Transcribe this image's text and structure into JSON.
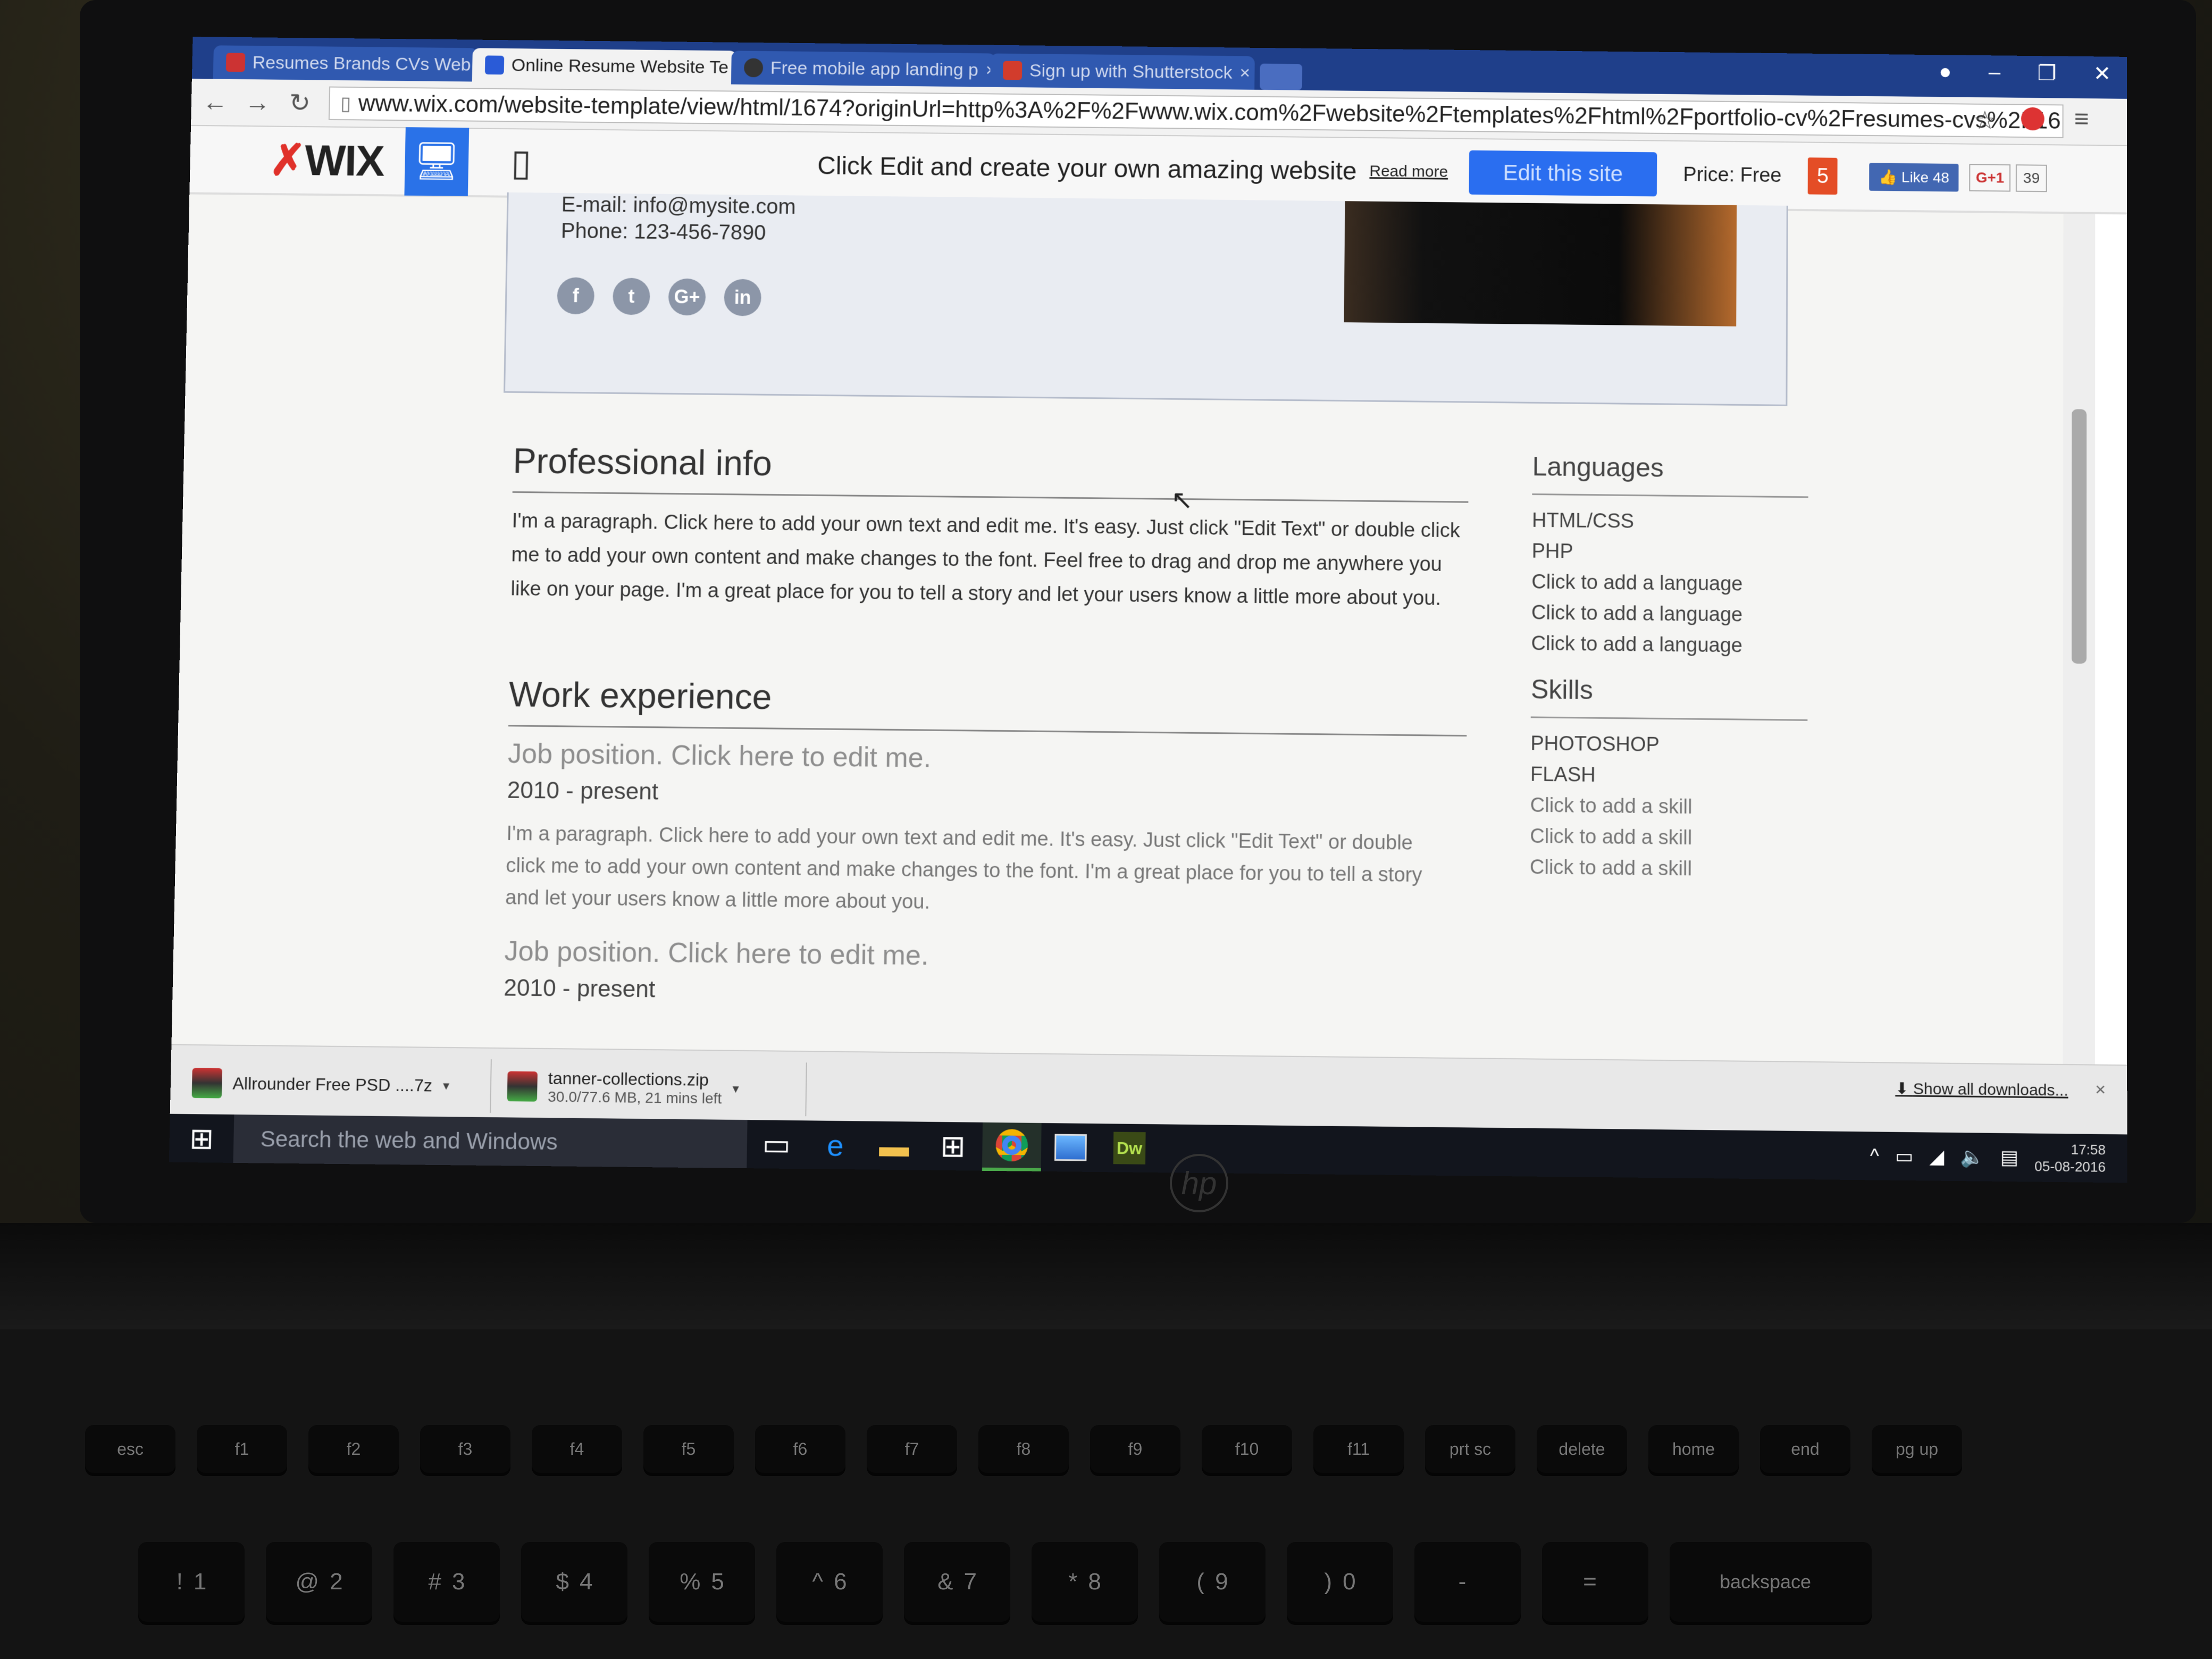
{
  "browser": {
    "tabs": [
      {
        "label": "Resumes Brands CVs Web",
        "active": false
      },
      {
        "label": "Online Resume Website Te",
        "active": true
      },
      {
        "label": "Free mobile app landing p",
        "active": false
      },
      {
        "label": "Sign up with Shutterstock",
        "active": false
      }
    ],
    "url": "www.wix.com/website-template/view/html/1674?originUrl=http%3A%2F%2Fwww.wix.com%2Fwebsite%2Ftemplates%2Fhtml%2Fportfolio-cv%2Fresumes-cvs%2F16"
  },
  "wixbar": {
    "logo": "WIX",
    "message": "Click Edit and create your own amazing website",
    "read_more": "Read more",
    "edit_button": "Edit this site",
    "price": "Price: Free",
    "html5": "5",
    "like": "Like 48",
    "gplus": "G+1",
    "gplus_count": "39"
  },
  "contact": {
    "email": "E-mail: info@mysite.com",
    "phone": "Phone: 123-456-7890",
    "social": [
      "f",
      "t",
      "G+",
      "in"
    ]
  },
  "main": {
    "professional_title": "Professional info",
    "professional_para": "I'm a paragraph. Click here to add your own text and edit me. It's easy. Just click \"Edit Text\" or double click me to add your own content and make changes to the font. Feel free to drag and drop me anywhere you like on your page. I'm a great place for you to tell a story and let your users know a little more about you.",
    "work_title": "Work experience",
    "jobs": [
      {
        "position": "Job position. Click here to edit me.",
        "dates": "2010 - present",
        "para": "I'm a paragraph. Click here to add your own text and edit me. It's easy. Just click \"Edit Text\" or double click me to add your own content and make changes to the font. I'm a great place for you to tell a story and let your users know a little more about you."
      },
      {
        "position": "Job position. Click here to edit me.",
        "dates": "2010 - present"
      }
    ]
  },
  "sidebar": {
    "languages_title": "Languages",
    "languages": [
      "HTML/CSS",
      "PHP",
      "Click to add a language",
      "Click to add a language",
      "Click to add a language"
    ],
    "skills_title": "Skills",
    "skills": [
      "PHOTOSHOP",
      "FLASH",
      "Click to add a skill",
      "Click to add a skill",
      "Click to add a skill"
    ]
  },
  "downloads": {
    "items": [
      {
        "name": "Allrounder Free PSD ....7z",
        "sub": ""
      },
      {
        "name": "tanner-collections.zip",
        "sub": "30.0/77.6 MB, 21 mins left"
      }
    ],
    "show_all": "Show all downloads..."
  },
  "taskbar": {
    "search_placeholder": "Search the web and Windows",
    "clock_time": "17:58",
    "clock_date": "05-08-2016",
    "dw_label": "Dw"
  },
  "laptop": {
    "brand": "hp",
    "keys_row1": [
      "esc",
      "f1",
      "f2",
      "f3",
      "f4",
      "f5",
      "f6",
      "f7",
      "f8",
      "f9",
      "f10",
      "f11",
      "prt sc",
      "delete",
      "home",
      "end",
      "pg up"
    ],
    "keys_row2": [
      "!",
      "@",
      "#",
      "$",
      "%",
      "^",
      "&",
      "*",
      "(",
      ")",
      "-",
      "=",
      "backspace"
    ],
    "keys_row2_nums": [
      "1",
      "2",
      "3",
      "4",
      "5",
      "6",
      "7",
      "8",
      "9",
      "0",
      "",
      "",
      ""
    ]
  }
}
